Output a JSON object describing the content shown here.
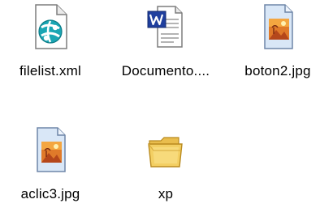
{
  "desktop": {
    "items": [
      {
        "label": "filelist.xml",
        "icon": "xml-file-icon"
      },
      {
        "label": "Documento....",
        "icon": "word-document-icon"
      },
      {
        "label": "boton2.jpg",
        "icon": "jpg-image-icon"
      },
      {
        "label": "aclic3.jpg",
        "icon": "jpg-image-icon"
      },
      {
        "label": "xp",
        "icon": "folder-icon"
      }
    ]
  },
  "colors": {
    "xml_accent": "#1aa6b4",
    "word_blue": "#1f3f9e",
    "image_orange": "#e07a2a",
    "folder_yellow": "#f3cf63"
  }
}
